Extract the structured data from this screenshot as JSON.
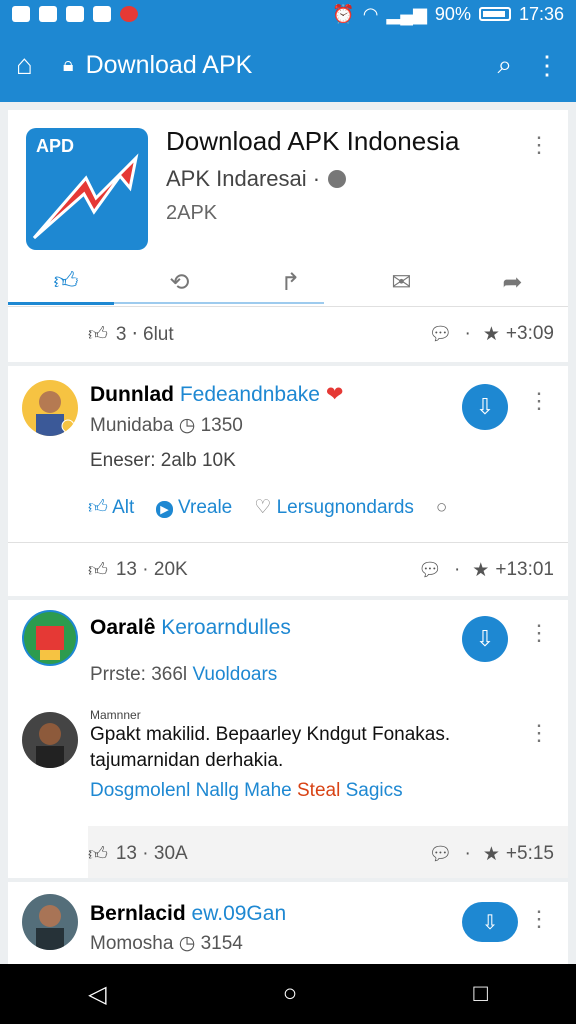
{
  "status_bar": {
    "battery": "90%",
    "time": "17:36"
  },
  "app_bar": {
    "title": "Download APK"
  },
  "page_card": {
    "name": "Download APK Indonesia",
    "subtitle": "APK Indaresai ·",
    "category": "2APK",
    "logo_text": "APD",
    "likes": "3 ⋅ 6lut",
    "time": "+3:09"
  },
  "posts": [
    {
      "author": "Dunnlad",
      "author_tag": "Fedeandnbake",
      "meta": "Munidaba",
      "meta_count": "1350",
      "body": "Eneser: 2alb 10K",
      "actions": [
        "Alt",
        "Vreale",
        "Lersugnondards"
      ],
      "likes": "13 · 20K",
      "time": "+13:01"
    },
    {
      "author": "Oaralê",
      "author_tag": "Keroarndulles",
      "body_label": "Prrste: 366l",
      "body_link": "Vuoldoars",
      "reply_tag": "Mamnner",
      "reply_text": "Gpakt makilid. Bepaarley Kndgut Fonakas. tajumarnidan derhakia.",
      "reply_link_a": "Dosgmolenl Nallg Mahe",
      "reply_link_b": "Steal",
      "reply_link_c": "Sagics",
      "likes": "13 · 30A",
      "time": "+5:15"
    },
    {
      "author": "Bernlacid",
      "author_tag": "ew.09Gan",
      "meta": "Momosha",
      "meta_count": "3154"
    }
  ]
}
